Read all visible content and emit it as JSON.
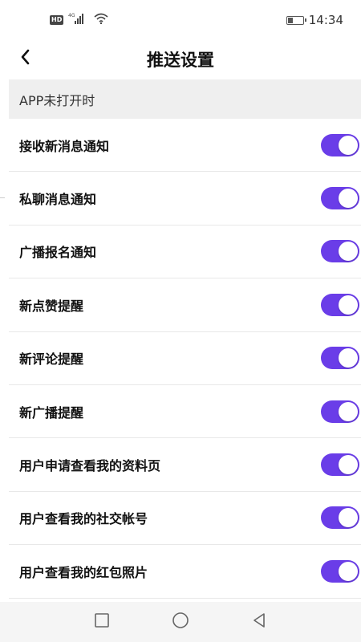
{
  "status_bar": {
    "network_badge": "HD",
    "network_type": "4G",
    "time": "14:34",
    "battery_level": 0.4
  },
  "header": {
    "title": "推送设置",
    "back_icon": "chevron-left-icon"
  },
  "section": {
    "title": "APP未打开时"
  },
  "settings": [
    {
      "label": "接收新消息通知",
      "enabled": true
    },
    {
      "label": "私聊消息通知",
      "enabled": true
    },
    {
      "label": "广播报名通知",
      "enabled": true
    },
    {
      "label": "新点赞提醒",
      "enabled": true
    },
    {
      "label": "新评论提醒",
      "enabled": true
    },
    {
      "label": "新广播提醒",
      "enabled": true
    },
    {
      "label": "用户申请查看我的资料页",
      "enabled": true
    },
    {
      "label": "用户查看我的社交帐号",
      "enabled": true
    },
    {
      "label": "用户查看我的红包照片",
      "enabled": true
    }
  ],
  "colors": {
    "accent": "#6a3de8",
    "section_bg": "#efefef"
  },
  "nav_bar": {
    "icons": [
      "square-icon",
      "circle-icon",
      "triangle-back-icon"
    ]
  }
}
